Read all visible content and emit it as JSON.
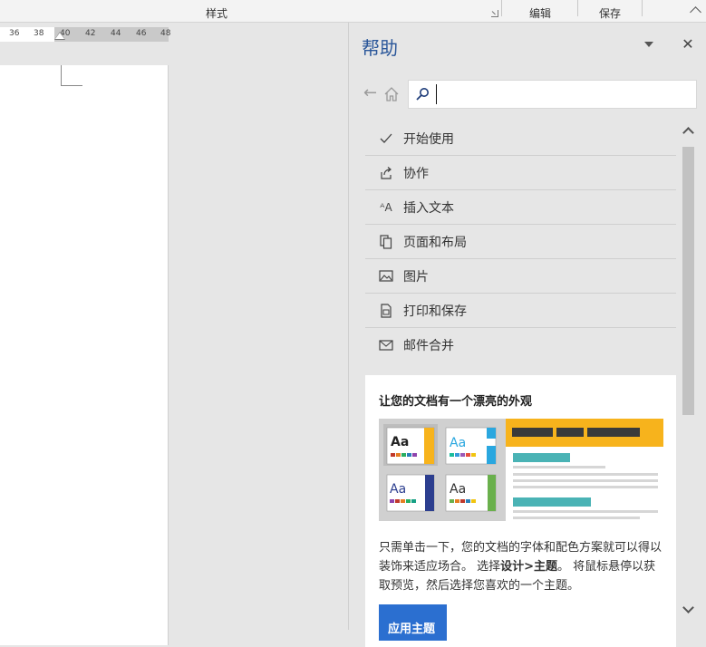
{
  "ribbon": {
    "styles_label": "样式",
    "edit_label": "编辑",
    "save_label": "保存"
  },
  "ruler": {
    "ticks": [
      "36",
      "38",
      "40",
      "42",
      "44",
      "46",
      "48"
    ]
  },
  "help_pane": {
    "title": "帮助",
    "options_icon": "chevron-down-icon",
    "close_icon": "close-icon",
    "back_icon": "back-arrow-icon",
    "home_icon": "home-icon",
    "search": {
      "value": "",
      "placeholder": "",
      "icon": "search-icon"
    },
    "topics": [
      {
        "label": "开始使用",
        "icon": "checkmark-icon"
      },
      {
        "label": "协作",
        "icon": "share-icon"
      },
      {
        "label": "插入文本",
        "icon": "text-size-icon"
      },
      {
        "label": "页面和布局",
        "icon": "pages-icon"
      },
      {
        "label": "图片",
        "icon": "picture-icon"
      },
      {
        "label": "打印和保存",
        "icon": "print-icon"
      },
      {
        "label": "邮件合并",
        "icon": "mail-icon"
      }
    ],
    "promo": {
      "title": "让您的文档有一个漂亮的外观",
      "body_1": "只需单击一下，您的文档的字体和配色方案就可以得以装饰来适应场合。 选择",
      "body_bold": "设计>主题",
      "body_2": "。 将鼠标悬停以获取预览，然后选择您喜欢的一个主题。",
      "button_label": "应用主题",
      "theme_sample_text": "Aa"
    }
  },
  "colors": {
    "accent_blue": "#2b579a",
    "button_blue": "#2b6fd0",
    "orange": "#f7b31c",
    "teal": "#4ab3b5"
  }
}
